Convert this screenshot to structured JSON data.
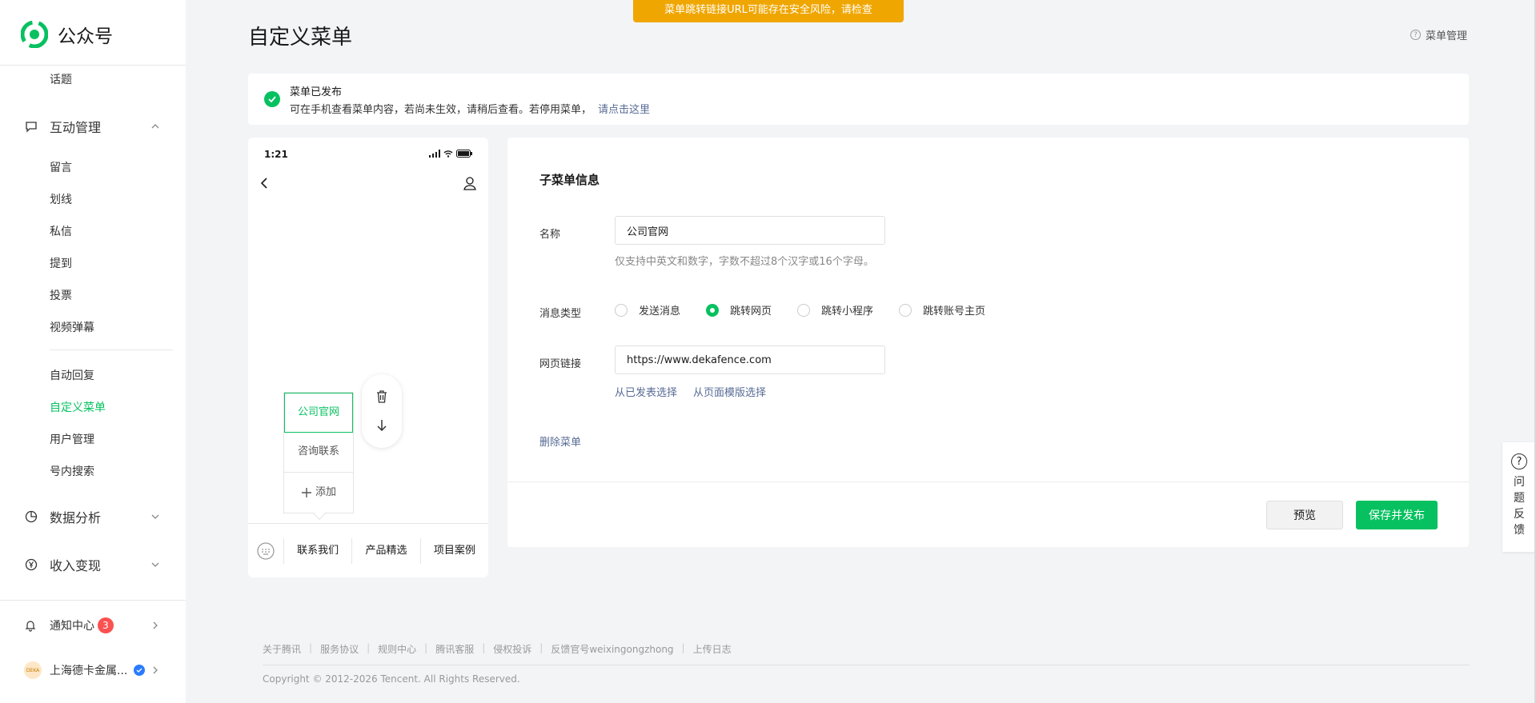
{
  "app": {
    "name": "公众号"
  },
  "banner": {
    "warning": "菜单跳转链接URL可能存在安全风险，请检查"
  },
  "page": {
    "title": "自定义菜单",
    "help_label": "菜单管理"
  },
  "sidebar": {
    "top_item": "话题",
    "group_interact": {
      "label": "互动管理",
      "items": [
        "留言",
        "划线",
        "私信",
        "提到",
        "投票",
        "视频弹幕"
      ]
    },
    "menu_items": [
      "自动回复",
      "自定义菜单",
      "用户管理",
      "号内搜索"
    ],
    "group_data": {
      "label": "数据分析"
    },
    "group_income": {
      "label": "收入变现"
    },
    "notifications": {
      "label": "通知中心",
      "count": "3"
    },
    "account": {
      "name": "上海德卡金属...",
      "avatar_text": "DEKA"
    }
  },
  "notice": {
    "title": "菜单已发布",
    "text": "可在手机查看菜单内容，若尚未生效，请稍后查看。若停用菜单，",
    "link": "请点击这里"
  },
  "phone": {
    "time": "1:21",
    "submenu": [
      "公司官网",
      "咨询联系"
    ],
    "add_label": "添加",
    "tabs": [
      "联系我们",
      "产品精选",
      "项目案例"
    ]
  },
  "form": {
    "section_title": "子菜单信息",
    "name_label": "名称",
    "name_value": "公司官网",
    "name_hint": "仅支持中英文和数字，字数不超过8个汉字或16个字母。",
    "type_label": "消息类型",
    "types": [
      "发送消息",
      "跳转网页",
      "跳转小程序",
      "跳转账号主页"
    ],
    "selected_type": "跳转网页",
    "url_label": "网页链接",
    "url_value": "https://www.dekafence.com",
    "pick_published": "从已发表选择",
    "pick_template": "从页面模版选择",
    "delete_label": "删除菜单",
    "preview_label": "预览",
    "save_label": "保存并发布"
  },
  "footer": {
    "links": [
      "关于腾讯",
      "服务协议",
      "规则中心",
      "腾讯客服",
      "侵权投诉",
      "反馈官号weixingongzhong",
      "上传日志"
    ],
    "copyright": "Copyright © 2012-2026 Tencent. All Rights Reserved."
  },
  "feedback": {
    "label": "问题反馈",
    "chars": [
      "问",
      "题",
      "反",
      "馈"
    ]
  },
  "colors": {
    "accent": "#07c160",
    "link": "#576b95",
    "warning": "#f0a600",
    "badge": "#fa5151"
  },
  "icons": [
    "logo-icon",
    "chat-icon",
    "chevron-up-icon",
    "chevron-down-icon",
    "pie-chart-icon",
    "yen-icon",
    "bell-icon",
    "chevron-right-icon",
    "check-circle-icon",
    "trash-icon",
    "arrow-down-icon",
    "plus-icon",
    "back-icon",
    "person-icon",
    "keyboard-icon",
    "help-icon"
  ]
}
